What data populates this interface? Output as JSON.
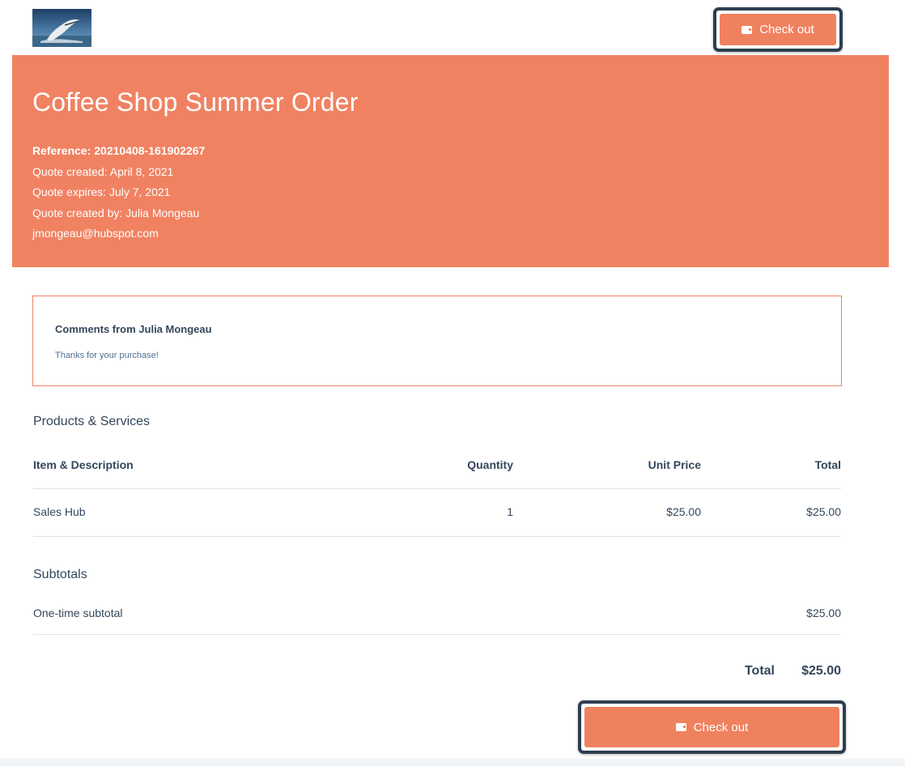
{
  "header": {
    "logo_icon": "whale-photo-logo",
    "checkout_label": "Check out",
    "checkout_icon": "wallet-icon"
  },
  "banner": {
    "title": "Coffee Shop Summer Order",
    "reference": "Reference: 20210408-161902267",
    "created": "Quote created: April 8, 2021",
    "expires": "Quote expires: July 7, 2021",
    "created_by": "Quote created by: Julia Mongeau",
    "email": "jmongeau@hubspot.com",
    "color": "#f08262"
  },
  "comments": {
    "title": "Comments from Julia Mongeau",
    "body": "Thanks for your purchase!"
  },
  "products": {
    "section_title": "Products & Services",
    "columns": [
      "Item & Description",
      "Quantity",
      "Unit Price",
      "Total"
    ],
    "rows": [
      {
        "item": "Sales Hub",
        "quantity": "1",
        "unit_price": "$25.00",
        "total": "$25.00"
      }
    ]
  },
  "subtotals": {
    "section_title": "Subtotals",
    "one_time_label": "One-time subtotal",
    "one_time_value": "$25.00"
  },
  "total": {
    "label": "Total",
    "value": "$25.00"
  },
  "footer": {
    "checkout_label": "Check out"
  },
  "colors": {
    "accent": "#f0815f",
    "text": "#33475b",
    "button_outline": "#2d3e50"
  }
}
